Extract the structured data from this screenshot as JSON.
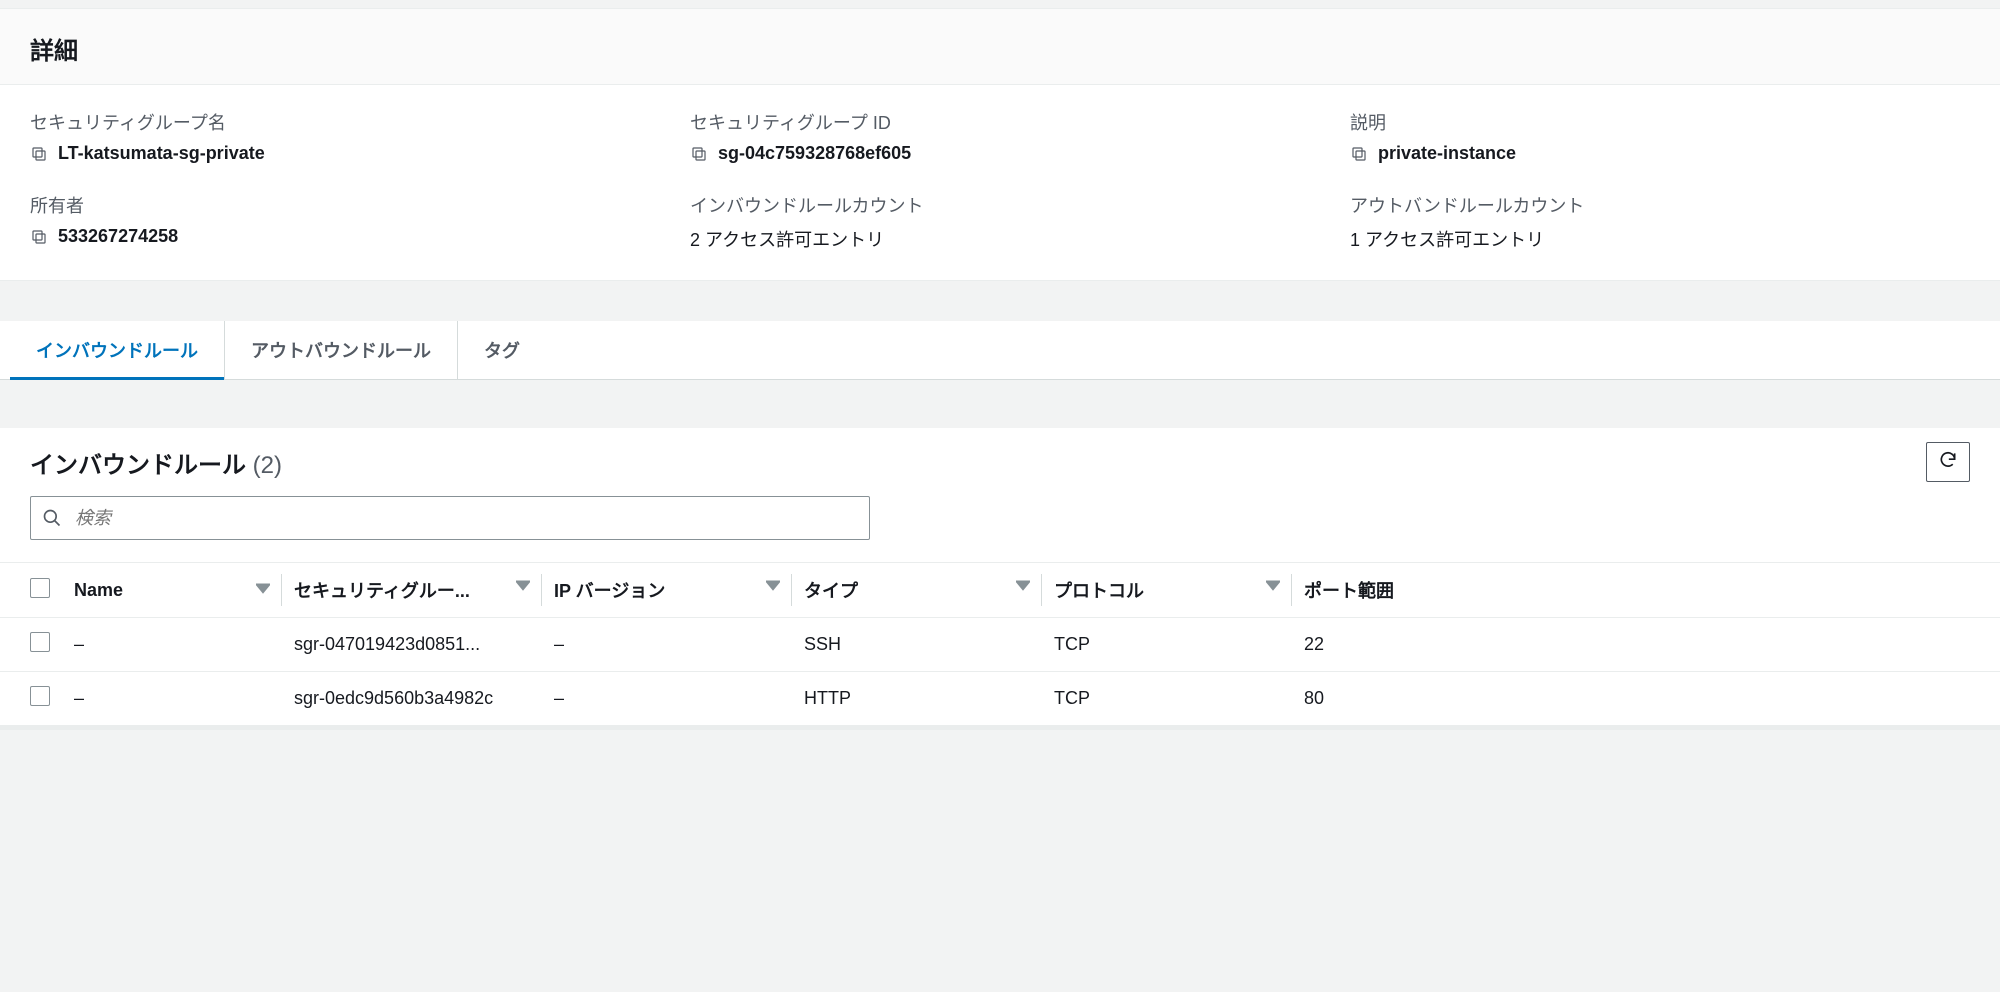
{
  "details": {
    "title": "詳細",
    "fields": {
      "sg_name": {
        "label": "セキュリティグループ名",
        "value": "LT-katsumata-sg-private"
      },
      "sg_id": {
        "label": "セキュリティグループ ID",
        "value": "sg-04c759328768ef605"
      },
      "desc": {
        "label": "説明",
        "value": "private-instance"
      },
      "owner": {
        "label": "所有者",
        "value": "533267274258"
      },
      "inbound_count": {
        "label": "インバウンドルールカウント",
        "value": "2 アクセス許可エントリ"
      },
      "outbound_count": {
        "label": "アウトバンドルールカウント",
        "value": "1 アクセス許可エントリ"
      }
    }
  },
  "tabs": {
    "inbound": "インバウンドルール",
    "outbound": "アウトバウンドルール",
    "tags": "タグ"
  },
  "rules": {
    "title": "インバウンドルール",
    "count_display": "(2)",
    "search_placeholder": "検索",
    "columns": {
      "name": "Name",
      "sgrule_id": "セキュリティグルー...",
      "ip_version": "IP バージョン",
      "type": "タイプ",
      "protocol": "プロトコル",
      "port_range": "ポート範囲"
    },
    "rows": [
      {
        "name": "–",
        "sgrule_id": "sgr-047019423d0851...",
        "ip_version": "–",
        "type": "SSH",
        "protocol": "TCP",
        "port_range": "22"
      },
      {
        "name": "–",
        "sgrule_id": "sgr-0edc9d560b3a4982c",
        "ip_version": "–",
        "type": "HTTP",
        "protocol": "TCP",
        "port_range": "80"
      }
    ]
  }
}
